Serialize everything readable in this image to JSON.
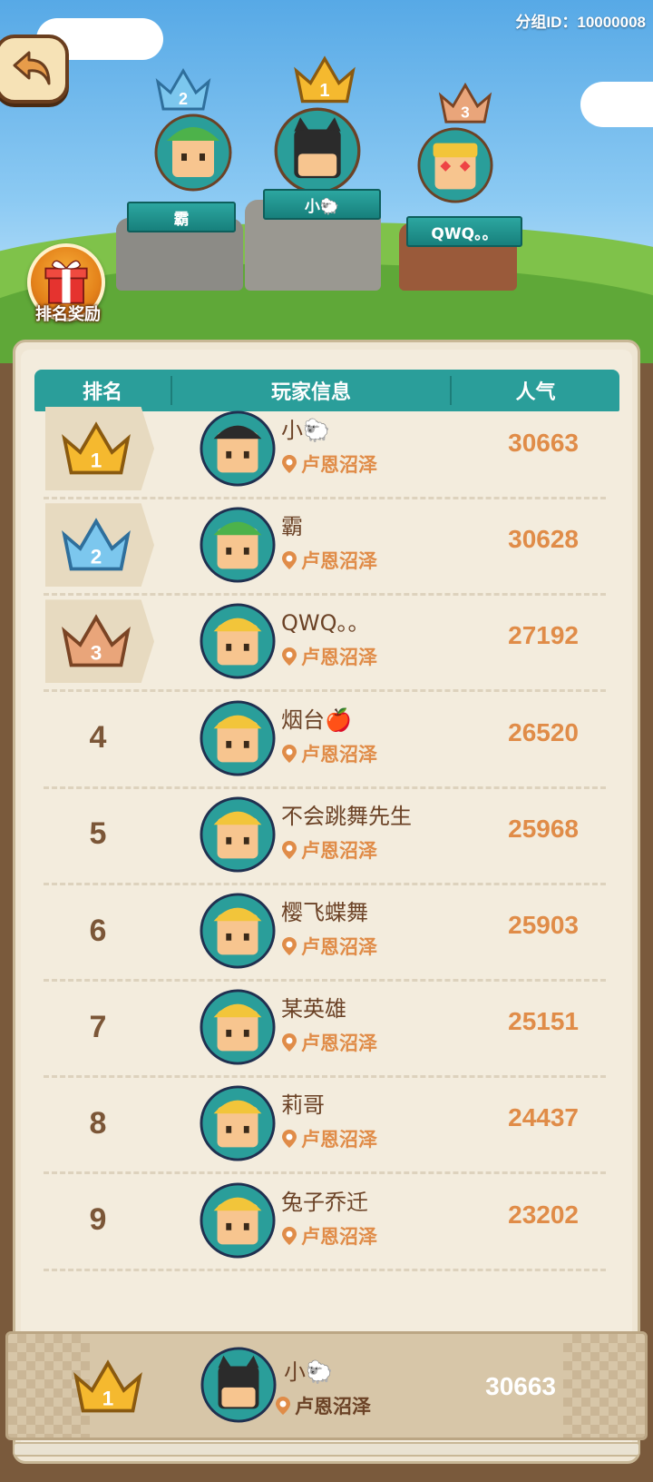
{
  "header": {
    "group_id": "分组ID：10000008",
    "reward_label": "排名奖励"
  },
  "podium": [
    {
      "rank": 2,
      "name": "霸"
    },
    {
      "rank": 1,
      "name": "小🐑"
    },
    {
      "rank": 3,
      "name": "QWQ。。"
    }
  ],
  "table": {
    "columns": [
      "排名",
      "玩家信息",
      "人气"
    ],
    "rows": [
      {
        "rank": "1",
        "name": "小🐑",
        "location": "卢恩沼泽",
        "popularity": "30663"
      },
      {
        "rank": "2",
        "name": "霸",
        "location": "卢恩沼泽",
        "popularity": "30628"
      },
      {
        "rank": "3",
        "name": "QWQ。。",
        "location": "卢恩沼泽",
        "popularity": "27192"
      },
      {
        "rank": "4",
        "name": "烟台🍎",
        "location": "卢恩沼泽",
        "popularity": "26520"
      },
      {
        "rank": "5",
        "name": "不会跳舞先生",
        "location": "卢恩沼泽",
        "popularity": "25968"
      },
      {
        "rank": "6",
        "name": "樱飞蝶舞",
        "location": "卢恩沼泽",
        "popularity": "25903"
      },
      {
        "rank": "7",
        "name": "某英雄",
        "location": "卢恩沼泽",
        "popularity": "25151"
      },
      {
        "rank": "8",
        "name": "莉哥",
        "location": "卢恩沼泽",
        "popularity": "24437"
      },
      {
        "rank": "9",
        "name": "兔子乔迁",
        "location": "卢恩沼泽",
        "popularity": "23202"
      }
    ]
  },
  "my_rank": {
    "rank": "1",
    "name": "小🐑",
    "location": "卢恩沼泽",
    "popularity": "30663"
  },
  "colors": {
    "gold": "#f5b92f",
    "silver": "#7cc7ee",
    "bronze": "#e9a57a",
    "teal": "#2a9e9a",
    "accent": "#e08c48"
  }
}
